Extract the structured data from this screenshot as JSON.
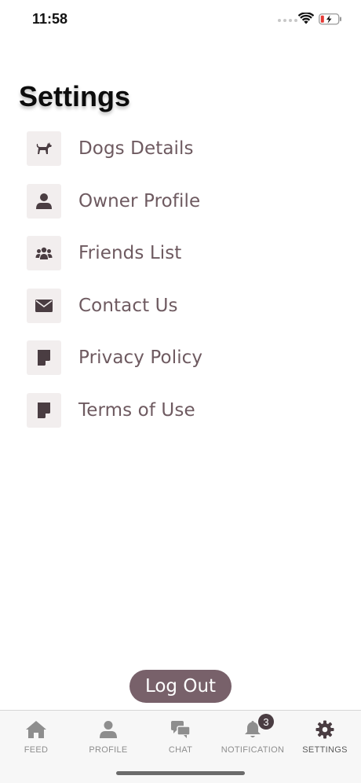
{
  "status_bar": {
    "time": "11:58"
  },
  "title": "Settings",
  "menu": [
    {
      "label": "Dogs Details",
      "icon": "dog-icon"
    },
    {
      "label": "Owner Profile",
      "icon": "person-icon"
    },
    {
      "label": "Friends List",
      "icon": "group-icon"
    },
    {
      "label": "Contact Us",
      "icon": "envelope-icon"
    },
    {
      "label": "Privacy Policy",
      "icon": "document-icon"
    },
    {
      "label": "Terms of Use",
      "icon": "document-icon"
    }
  ],
  "logout_label": "Log Out",
  "tabs": [
    {
      "label": "FEED",
      "icon": "home-icon"
    },
    {
      "label": "PROFILE",
      "icon": "person-icon"
    },
    {
      "label": "CHAT",
      "icon": "chat-icon"
    },
    {
      "label": "NOTIFICATION",
      "icon": "bell-icon",
      "badge": "3"
    },
    {
      "label": "SETTINGS",
      "icon": "gear-icon",
      "active": true
    }
  ],
  "colors": {
    "accent": "#78616a",
    "menu_text": "#6e5a60",
    "icon_bg": "#f2eeee",
    "tab_inactive": "#8e8e8e",
    "tab_active": "#4a3d42"
  }
}
